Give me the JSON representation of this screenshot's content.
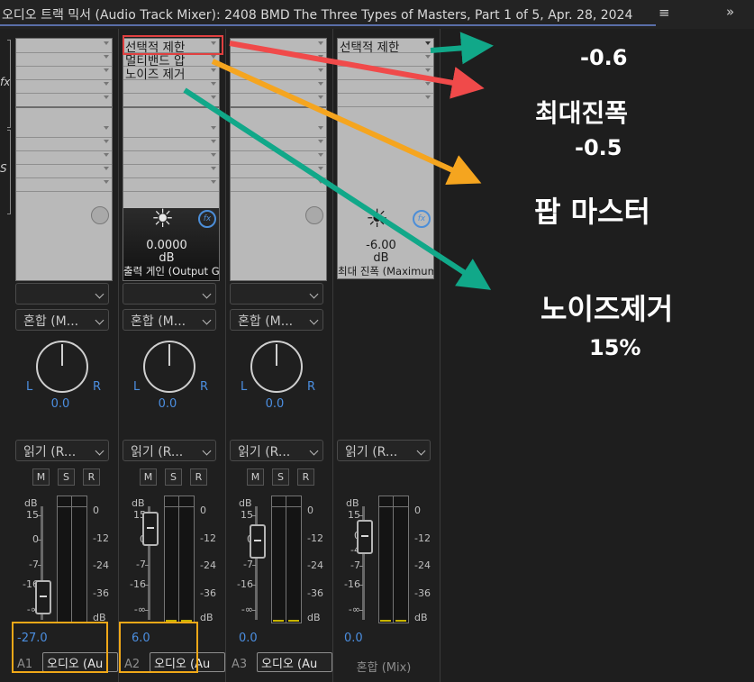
{
  "window": {
    "title": "오디오 트랙 믹서 (Audio Track Mixer): 2408 BMD The Three Types of Masters, Part 1 of 5, Apr. 28, 2024",
    "menu_glyph": "≡",
    "expand_glyph": "»"
  },
  "left_icons": {
    "fx": "fx",
    "sends": "S"
  },
  "channels": [
    {
      "name": "A1",
      "effects": [],
      "fx_param": null,
      "send": "",
      "mode": "혼합 (M...",
      "pan": {
        "value": "0.0",
        "l": "L",
        "r": "R"
      },
      "automation": "읽기 (R...",
      "buttons": [
        "M",
        "S",
        "R"
      ],
      "volume": "-27.0",
      "output": "오디오 (Au"
    },
    {
      "name": "A2",
      "effects": [
        "선택적 제한",
        "멀티밴드 압",
        "노이즈 제거"
      ],
      "fx_param": {
        "value": "0.0000",
        "unit": "dB",
        "name": "출력 게인 (Output Ga"
      },
      "send": "",
      "mode": "혼합 (M...",
      "pan": {
        "value": "0.0",
        "l": "L",
        "r": "R"
      },
      "automation": "읽기 (R...",
      "buttons": [
        "M",
        "S",
        "R"
      ],
      "volume": "6.0",
      "output": "오디오 (Au"
    },
    {
      "name": "A3",
      "effects": [],
      "fx_param": null,
      "send": "",
      "mode": "혼합 (M...",
      "pan": {
        "value": "0.0",
        "l": "L",
        "r": "R"
      },
      "automation": "읽기 (R...",
      "buttons": [
        "M",
        "S",
        "R"
      ],
      "volume": "0.0",
      "output": "오디오 (Au"
    },
    {
      "name": "혼합 (Mix)",
      "effects": [
        "선택적 제한"
      ],
      "fx_param": {
        "value": "-6.00",
        "unit": "dB",
        "name": "최대 진폭 (Maximum Am"
      },
      "automation": "읽기 (R...",
      "volume": "0.0"
    }
  ],
  "fader_scale": [
    "dB",
    "15",
    "0",
    "-7",
    "-16",
    "-∞"
  ],
  "mix_fader_scale": [
    "dB",
    "15",
    "0",
    "-4",
    "-7",
    "-16",
    "-∞"
  ],
  "meter_scale": [
    "0",
    "-12",
    "-24",
    "-36",
    "dB"
  ],
  "annotations": [
    {
      "text": "-0.6"
    },
    {
      "text": "최대진폭"
    },
    {
      "text": "-0.5"
    },
    {
      "text": "팝 마스터"
    },
    {
      "text": "노이즈제거"
    },
    {
      "text": "15%"
    }
  ],
  "colors": {
    "accent_blue": "#4b8ee0",
    "highlight_orange": "#f0a818",
    "highlight_red": "#e04040",
    "arrow_teal": "#11a889",
    "arrow_orange": "#f5a51f",
    "arrow_red": "#f04a4a"
  },
  "icons": [
    "menu-icon",
    "expand-icon",
    "fx-icon",
    "knob-icon",
    "fx-badge-icon",
    "chevron-down-icon"
  ]
}
